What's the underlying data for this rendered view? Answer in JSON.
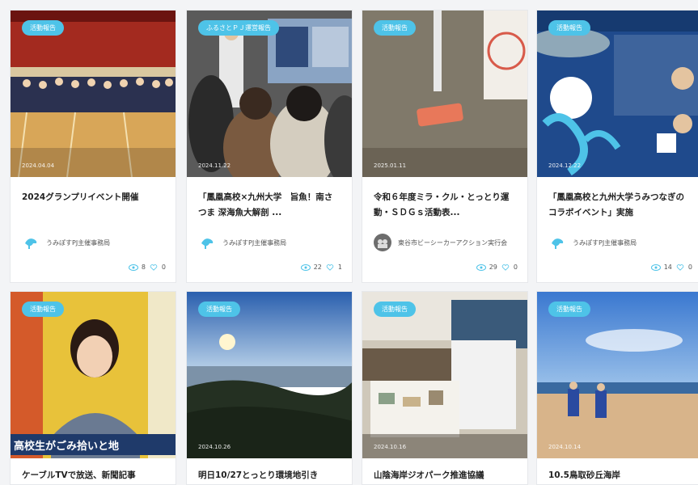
{
  "colors": {
    "tag_bg": "#4ec3e8",
    "accent": "#4ec3e8"
  },
  "cards": [
    {
      "tag": "活動報告",
      "date": "2024.04.04",
      "title": "2024グランプリイベント開催",
      "author": "うみぽすPJ主催事務局",
      "views": "8",
      "likes": "0",
      "image": "gymnasium-group-photo"
    },
    {
      "tag": "ふるさとＰＪ運営報告",
      "date": "2024.11.22",
      "title": "「鳳凰高校×九州大学　旨魚！南さつま 深海魚大解剖 ...",
      "author": "うみぽすPJ主催事務局",
      "views": "22",
      "likes": "1",
      "image": "classroom-presentation"
    },
    {
      "tag": "活動報告",
      "date": "2025.01.11",
      "title": "令和６年度ミラ・クル・とっとり運動・ＳＤＧｓ活動表...",
      "author": "東谷市ビーシーカーアクション実行会",
      "views": "29",
      "likes": "0",
      "image": "beach-trash"
    },
    {
      "tag": "活動報告",
      "date": "2024.12.22",
      "title": "「鳳凰高校と九州大学うみつなぎのコラボイベント」実施",
      "author": "うみぽすPJ主催事務局",
      "views": "14",
      "likes": "0",
      "image": "event-poster"
    },
    {
      "tag": "活動報告",
      "date": "",
      "title": "ケーブルTVで放送、新聞記事",
      "author": "",
      "views": "",
      "likes": "",
      "image": "tv-caption",
      "caption": "高校生がごみ拾いと地"
    },
    {
      "tag": "活動報告",
      "date": "2024.10.26",
      "title": "明日10/27とっとり環境地引き",
      "author": "",
      "views": "",
      "likes": "",
      "image": "sunset-coast"
    },
    {
      "tag": "活動報告",
      "date": "2024.10.16",
      "title": "山陰海岸ジオパーク推進協議",
      "author": "",
      "views": "",
      "likes": "",
      "image": "exhibition-booth"
    },
    {
      "tag": "活動報告",
      "date": "2024.10.14",
      "title": "10.5鳥取砂丘海岸",
      "author": "",
      "views": "",
      "likes": "",
      "image": "sand-dunes"
    }
  ]
}
